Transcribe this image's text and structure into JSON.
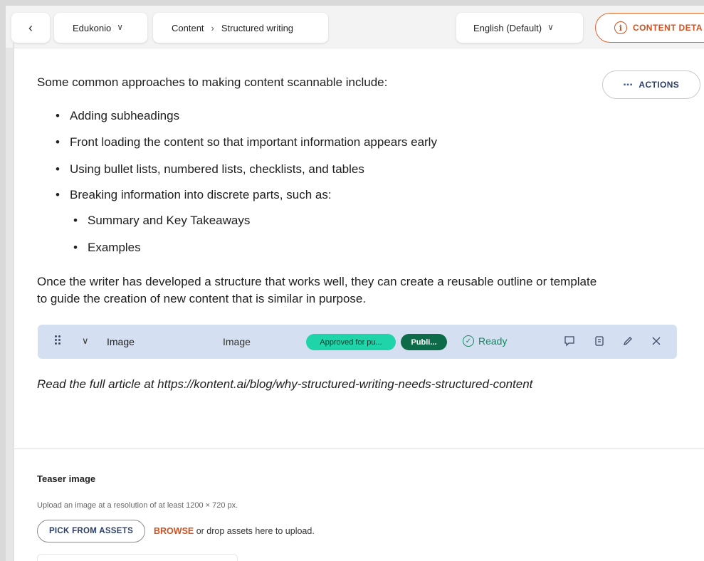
{
  "topbar": {
    "back_icon": "chevron-left-icon",
    "project": "Edukonio",
    "breadcrumb": {
      "section": "Content",
      "item": "Structured writing"
    },
    "language": "English (Default)",
    "details_label": "CONTENT DETA"
  },
  "actions_label": "ACTIONS",
  "content": {
    "intro": "Some common approaches to making content scannable include:",
    "bullets": [
      "Adding subheadings",
      "Front loading the content so that important information appears early",
      "Using bullet lists, numbered lists, checklists, and tables",
      "Breaking information into discrete parts, such as:"
    ],
    "sub_bullets": [
      "Summary and Key Takeaways",
      "Examples"
    ],
    "outro_line1": "Once the writer has developed a structure that works well, they can create a reusable outline or template",
    "outro_line2": "to guide the creation of new content that is similar in purpose.",
    "footer_italic": "Read the full article at https://kontent.ai/blog/why-structured-writing-needs-structured-content"
  },
  "component": {
    "name": "Image",
    "type": "Image",
    "workflow_badge": "Approved for pu...",
    "publish_badge": "Publi...",
    "status": "Ready",
    "colors": {
      "row_bg": "#d4dff2",
      "approved": "#1fd4a8",
      "published": "#0d6b4a",
      "ready": "#108a5c"
    }
  },
  "teaser": {
    "label": "Teaser image",
    "hint": "Upload an image at a resolution of at least 1200 × 720 px.",
    "pick_button": "PICK FROM ASSETS",
    "browse": "BROWSE",
    "browse_rest": " or drop assets here to upload."
  },
  "accent_color": "#d2501f"
}
